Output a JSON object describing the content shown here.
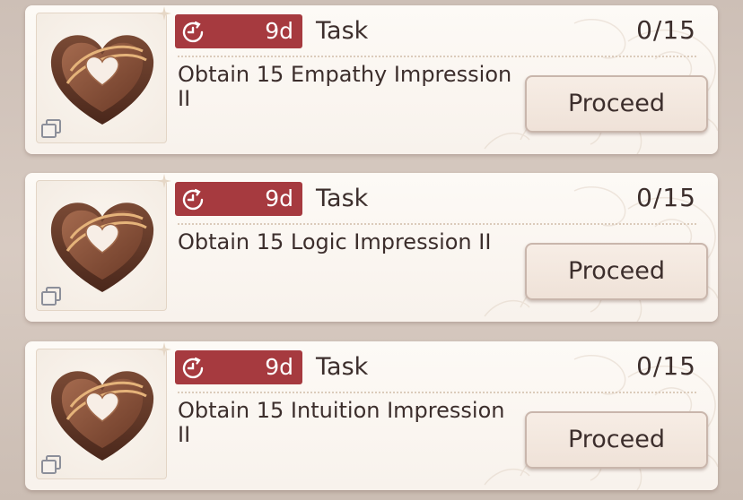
{
  "tasks": [
    {
      "timer": "9d",
      "label": "Task",
      "progress": "0/15",
      "description": "Obtain 15 Empathy Impression II",
      "button": "Proceed",
      "item_icon": "heart-chocolate-icon"
    },
    {
      "timer": "9d",
      "label": "Task",
      "progress": "0/15",
      "description": "Obtain 15 Logic Impression II",
      "button": "Proceed",
      "item_icon": "heart-chocolate-icon"
    },
    {
      "timer": "9d",
      "label": "Task",
      "progress": "0/15",
      "description": "Obtain 15 Intuition Impression II",
      "button": "Proceed",
      "item_icon": "heart-chocolate-icon"
    }
  ],
  "colors": {
    "timer_badge": "#a63a3f",
    "text": "#3c2e2c",
    "card": "#fbf6f1",
    "button": "#f3e7de"
  }
}
